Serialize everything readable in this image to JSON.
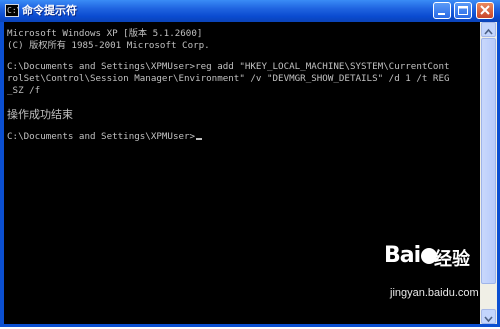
{
  "window": {
    "title": "命令提示符",
    "icon_text": "C:\\"
  },
  "console": {
    "lines": [
      "Microsoft Windows XP [版本 5.1.2600]",
      "(C) 版权所有 1985-2001 Microsoft Corp.",
      "",
      "C:\\Documents and Settings\\XPMUser>reg add \"HKEY_LOCAL_MACHINE\\SYSTEM\\CurrentCont",
      "rolSet\\Control\\Session Manager\\Environment\" /v \"DEVMGR_SHOW_DETAILS\" /d 1 /t REG",
      "_SZ /f",
      "",
      "操作成功结束",
      "",
      "C:\\Documents and Settings\\XPMUser>"
    ]
  },
  "watermark": {
    "brand": "Bai",
    "brand2": "经验",
    "url": "jingyan.baidu.com"
  },
  "colors": {
    "titlebar": "#0a4bd0",
    "console_bg": "#000000",
    "console_text": "#c0c0c0"
  }
}
